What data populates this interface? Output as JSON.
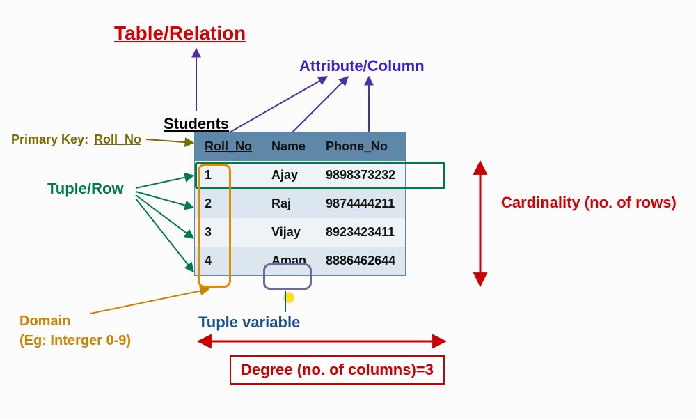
{
  "title": "Table/Relation",
  "attribute_label": "Attribute/Column",
  "table_name": "Students",
  "primary_key_label": "Primary Key:",
  "primary_key_value": "Roll_No",
  "tuple_label": "Tuple/Row",
  "domain_label": "Domain",
  "domain_example": "(Eg: Interger 0-9)",
  "tuple_variable_label": "Tuple variable",
  "cardinality_label": "Cardinality (no. of rows)",
  "degree_label": "Degree (no. of columns)=3",
  "table": {
    "columns": [
      "Roll_No",
      "Name",
      "Phone_No"
    ],
    "primary_key_col_index": 0,
    "rows": [
      {
        "Roll_No": "1",
        "Name": "Ajay",
        "Phone_No": "9898373232"
      },
      {
        "Roll_No": "2",
        "Name": "Raj",
        "Phone_No": "9874444211"
      },
      {
        "Roll_No": "3",
        "Name": "Vijay",
        "Phone_No": "8923423411"
      },
      {
        "Roll_No": "4",
        "Name": "Aman",
        "Phone_No": "8886462644"
      }
    ]
  },
  "colors": {
    "title": "#d40000",
    "attribute": "#3a1fd1",
    "primary_key": "#7a6a00",
    "tuple": "#007a4d",
    "domain": "#cc8400",
    "tuple_variable": "#1b4f8a",
    "cardinality": "#d40000",
    "degree": "#c80000",
    "table_header": "#5f88a8"
  }
}
